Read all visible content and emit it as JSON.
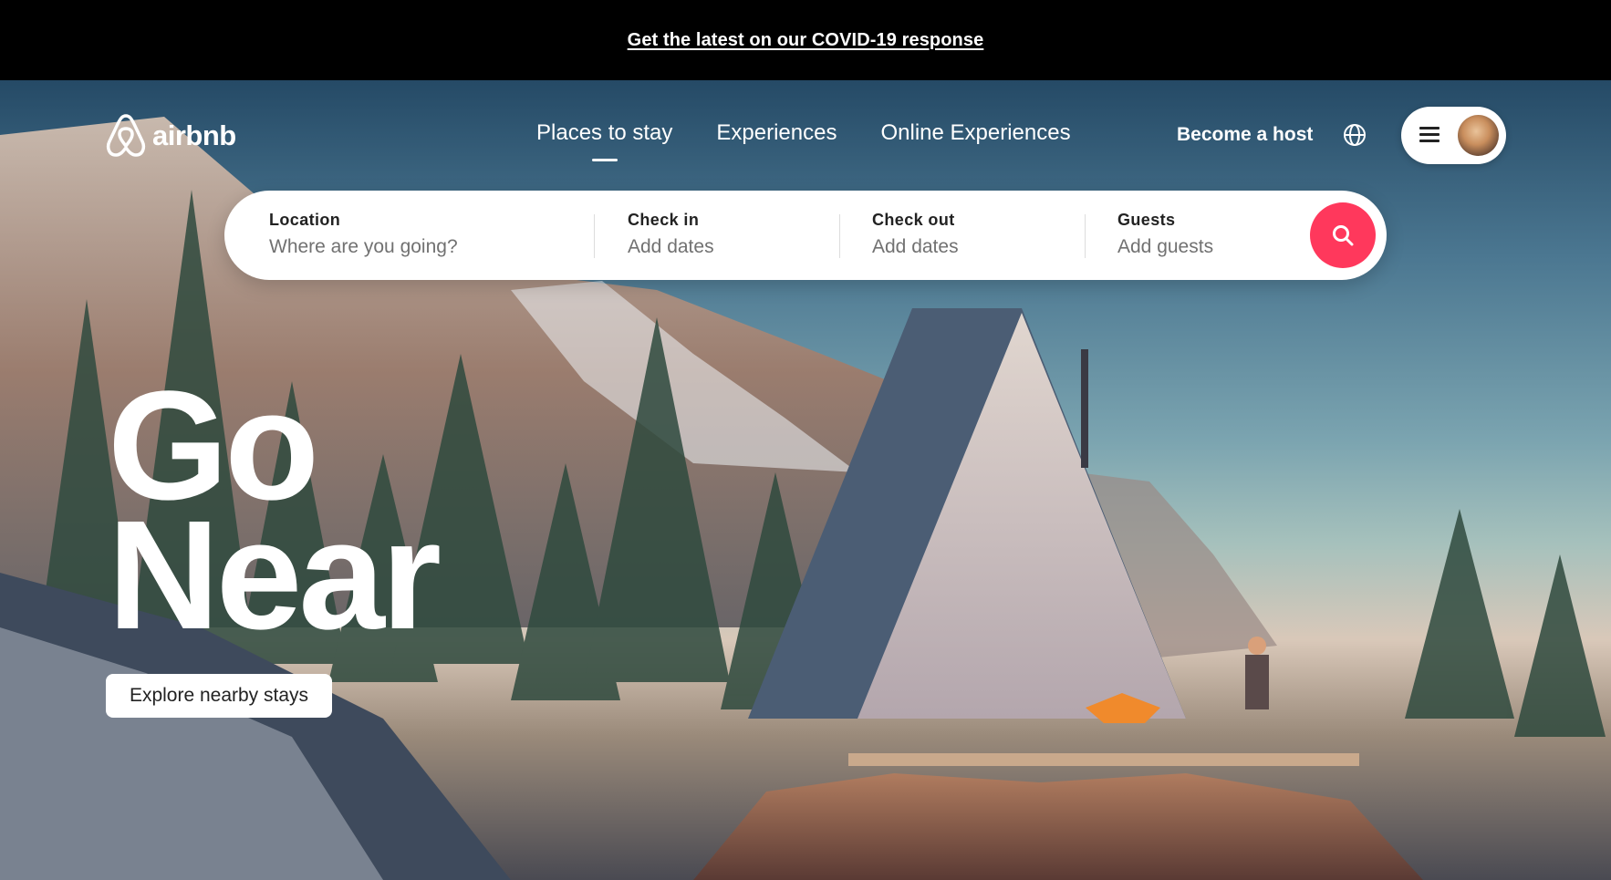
{
  "banner": {
    "link_text": "Get the latest on our COVID-19 response"
  },
  "header": {
    "brand": "airbnb",
    "tabs": [
      {
        "label": "Places to stay",
        "active": true
      },
      {
        "label": "Experiences",
        "active": false
      },
      {
        "label": "Online Experiences",
        "active": false
      }
    ],
    "become_host": "Become a host",
    "icons": {
      "globe": "globe-icon",
      "menu": "hamburger-icon",
      "logo": "airbnb-logo-icon"
    }
  },
  "search": {
    "location": {
      "label": "Location",
      "placeholder": "Where are you going?"
    },
    "checkin": {
      "label": "Check in",
      "placeholder": "Add dates"
    },
    "checkout": {
      "label": "Check out",
      "placeholder": "Add dates"
    },
    "guests": {
      "label": "Guests",
      "placeholder": "Add guests"
    },
    "button_icon": "search-icon"
  },
  "hero": {
    "headline_line1": "Go",
    "headline_line2": "Near",
    "cta": "Explore nearby stays"
  },
  "colors": {
    "accent": "#ff385c",
    "banner_bg": "#000000",
    "text_dark": "#222222",
    "placeholder": "#717171"
  }
}
